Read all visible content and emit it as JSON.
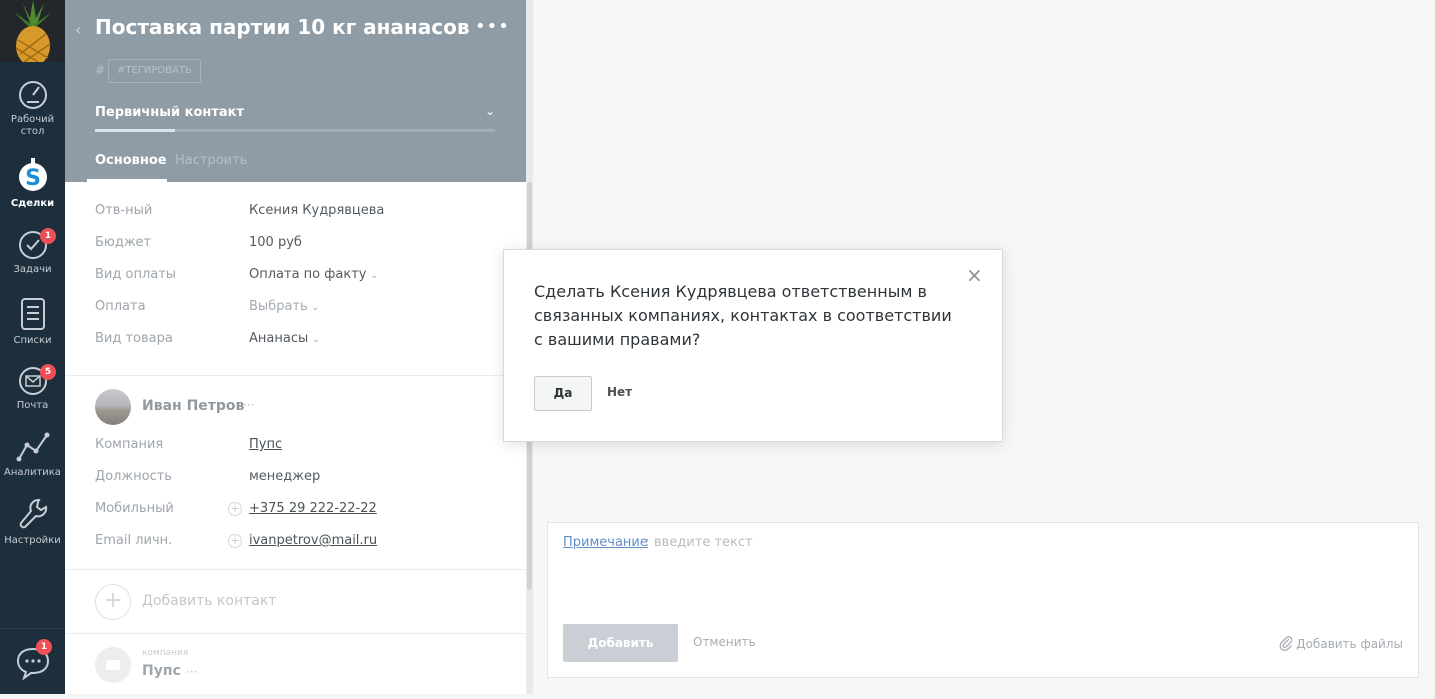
{
  "nav": {
    "items": [
      {
        "label": "Рабочий стол",
        "line1": "Рабочий",
        "line2": "стол",
        "icon": "dashboard-icon"
      },
      {
        "label": "Сделки",
        "icon": "deals-icon",
        "active": true
      },
      {
        "label": "Задачи",
        "icon": "tasks-icon",
        "badge": "1"
      },
      {
        "label": "Списки",
        "icon": "lists-icon"
      },
      {
        "label": "Почта",
        "icon": "mail-icon",
        "badge": "5"
      },
      {
        "label": "Аналитика",
        "icon": "analytics-icon"
      },
      {
        "label": "Настройки",
        "icon": "settings-icon"
      }
    ],
    "chat_badge": "1"
  },
  "card": {
    "title": "Поставка партии 10 кг ананасов",
    "hash": "#",
    "tag_button": "#ТЕГИРОВАТЬ",
    "stage": "Первичный контакт",
    "stage_progress": 0.2,
    "tabs": [
      "Основное",
      "Настроить"
    ],
    "fields": [
      {
        "label": "Отв-ный",
        "value": "Ксения Кудрявцева"
      },
      {
        "label": "Бюджет",
        "value": "100 руб"
      },
      {
        "label": "Вид оплаты",
        "value": "Оплата по факту",
        "dropdown": true
      },
      {
        "label": "Оплата",
        "value": "Выбрать",
        "dropdown": true
      },
      {
        "label": "Вид товара",
        "value": "Ананасы",
        "dropdown": true
      }
    ],
    "contact": {
      "name": "Иван Петров",
      "more": "···",
      "fields": [
        {
          "label": "Компания",
          "value": "Пупс"
        },
        {
          "label": "Должность",
          "value": "менеджер"
        },
        {
          "label": "Мобильный",
          "value": "+375 29 222-22-22"
        },
        {
          "label": "Email личн.",
          "value": "ivanpetrov@mail.ru"
        }
      ]
    },
    "add_contact": "Добавить контакт",
    "company": {
      "caption": "компания",
      "name": "Пупс",
      "more": "···"
    }
  },
  "note": {
    "label": "Примечание",
    "colon": ":",
    "placeholder": "введите текст",
    "add_button": "Добавить",
    "cancel": "Отменить",
    "attach": "Добавить файлы"
  },
  "modal": {
    "question": "Сделать Ксения Кудрявцева ответственным в связанных компаниях, контактах в соответствии с вашими правами?",
    "yes": "Да",
    "no": "Нет",
    "close": "×"
  },
  "colors": {
    "nav_bg": "#1d2e3c",
    "header_bg": "#8f9ca6",
    "badge": "#f04e54",
    "link": "#5f8ec9"
  }
}
